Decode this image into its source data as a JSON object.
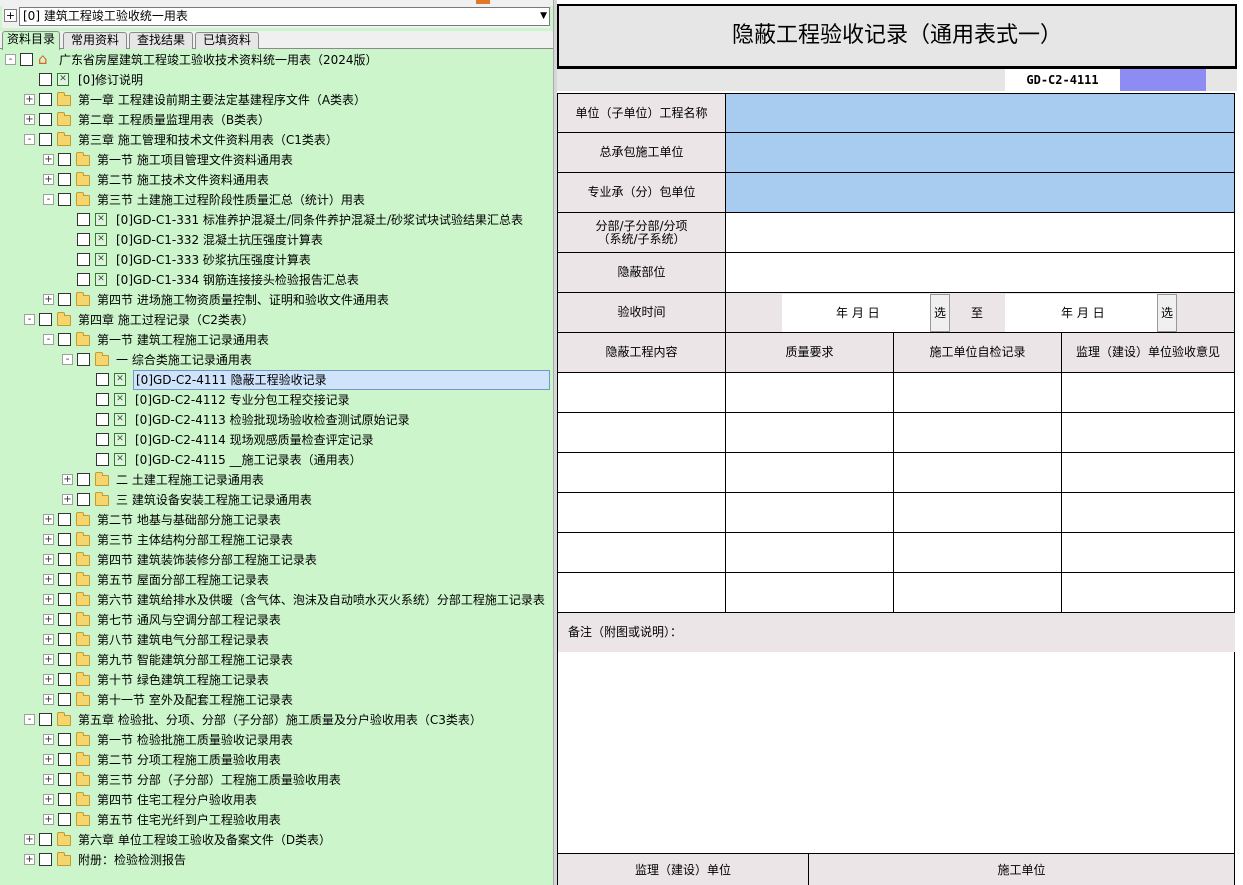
{
  "selector": {
    "expand_glyph": "+",
    "current": "[0] 建筑工程竣工验收统一用表",
    "arrow": "▼"
  },
  "tabs": [
    {
      "label": "资料目录",
      "active": true
    },
    {
      "label": "常用资料",
      "active": false
    },
    {
      "label": "查找结果",
      "active": false
    },
    {
      "label": "已填资料",
      "active": false
    }
  ],
  "tree": [
    {
      "depth": 0,
      "exp": "-",
      "icon": "home",
      "label": "广东省房屋建筑工程竣工验收技术资料统一用表（2024版）"
    },
    {
      "depth": 1,
      "exp": "",
      "icon": "file",
      "label": "[0]修订说明"
    },
    {
      "depth": 1,
      "exp": "+",
      "icon": "folder",
      "label": "第一章 工程建设前期主要法定基建程序文件（A类表）"
    },
    {
      "depth": 1,
      "exp": "+",
      "icon": "folder",
      "label": "第二章 工程质量监理用表（B类表）"
    },
    {
      "depth": 1,
      "exp": "-",
      "icon": "folder",
      "label": "第三章 施工管理和技术文件资料用表（C1类表）"
    },
    {
      "depth": 2,
      "exp": "+",
      "icon": "folder",
      "label": "第一节 施工项目管理文件资料通用表"
    },
    {
      "depth": 2,
      "exp": "+",
      "icon": "folder",
      "label": "第二节 施工技术文件资料通用表"
    },
    {
      "depth": 2,
      "exp": "-",
      "icon": "folder",
      "label": "第三节 土建施工过程阶段性质量汇总（统计）用表"
    },
    {
      "depth": 3,
      "exp": "",
      "icon": "file",
      "label": "[0]GD-C1-331 标准养护混凝土/同条件养护混凝土/砂浆试块试验结果汇总表"
    },
    {
      "depth": 3,
      "exp": "",
      "icon": "file",
      "label": "[0]GD-C1-332 混凝土抗压强度计算表"
    },
    {
      "depth": 3,
      "exp": "",
      "icon": "file",
      "label": "[0]GD-C1-333 砂浆抗压强度计算表"
    },
    {
      "depth": 3,
      "exp": "",
      "icon": "file",
      "label": "[0]GD-C1-334 钢筋连接接头检验报告汇总表"
    },
    {
      "depth": 2,
      "exp": "+",
      "icon": "folder",
      "label": "第四节 进场施工物资质量控制、证明和验收文件通用表"
    },
    {
      "depth": 1,
      "exp": "-",
      "icon": "folder",
      "label": "第四章 施工过程记录（C2类表）"
    },
    {
      "depth": 2,
      "exp": "-",
      "icon": "folder",
      "label": "第一节 建筑工程施工记录通用表"
    },
    {
      "depth": 3,
      "exp": "-",
      "icon": "folder",
      "label": "一 综合类施工记录通用表"
    },
    {
      "depth": 4,
      "exp": "",
      "icon": "file",
      "label": "[0]GD-C2-4111 隐蔽工程验收记录",
      "selected": true
    },
    {
      "depth": 4,
      "exp": "",
      "icon": "file",
      "label": "[0]GD-C2-4112 专业分包工程交接记录"
    },
    {
      "depth": 4,
      "exp": "",
      "icon": "file",
      "label": "[0]GD-C2-4113 检验批现场验收检查测试原始记录"
    },
    {
      "depth": 4,
      "exp": "",
      "icon": "file",
      "label": "[0]GD-C2-4114 现场观感质量检查评定记录"
    },
    {
      "depth": 4,
      "exp": "",
      "icon": "file",
      "label": "[0]GD-C2-4115 __施工记录表（通用表）"
    },
    {
      "depth": 3,
      "exp": "+",
      "icon": "folder",
      "label": "二 土建工程施工记录通用表"
    },
    {
      "depth": 3,
      "exp": "+",
      "icon": "folder",
      "label": "三 建筑设备安装工程施工记录通用表"
    },
    {
      "depth": 2,
      "exp": "+",
      "icon": "folder",
      "label": "第二节 地基与基础部分施工记录表"
    },
    {
      "depth": 2,
      "exp": "+",
      "icon": "folder",
      "label": "第三节 主体结构分部工程施工记录表"
    },
    {
      "depth": 2,
      "exp": "+",
      "icon": "folder",
      "label": "第四节 建筑装饰装修分部工程施工记录表"
    },
    {
      "depth": 2,
      "exp": "+",
      "icon": "folder",
      "label": "第五节 屋面分部工程施工记录表"
    },
    {
      "depth": 2,
      "exp": "+",
      "icon": "folder",
      "label": "第六节 建筑给排水及供暖（含气体、泡沫及自动喷水灭火系统）分部工程施工记录表"
    },
    {
      "depth": 2,
      "exp": "+",
      "icon": "folder",
      "label": "第七节 通风与空调分部工程记录表"
    },
    {
      "depth": 2,
      "exp": "+",
      "icon": "folder",
      "label": "第八节 建筑电气分部工程记录表"
    },
    {
      "depth": 2,
      "exp": "+",
      "icon": "folder",
      "label": "第九节 智能建筑分部工程施工记录表"
    },
    {
      "depth": 2,
      "exp": "+",
      "icon": "folder",
      "label": "第十节 绿色建筑工程施工记录表"
    },
    {
      "depth": 2,
      "exp": "+",
      "icon": "folder",
      "label": "第十一节 室外及配套工程施工记录表"
    },
    {
      "depth": 1,
      "exp": "-",
      "icon": "folder",
      "label": "第五章 检验批、分项、分部（子分部）施工质量及分户验收用表（C3类表）"
    },
    {
      "depth": 2,
      "exp": "+",
      "icon": "folder",
      "label": "第一节 检验批施工质量验收记录用表"
    },
    {
      "depth": 2,
      "exp": "+",
      "icon": "folder",
      "label": "第二节 分项工程施工质量验收用表"
    },
    {
      "depth": 2,
      "exp": "+",
      "icon": "folder",
      "label": "第三节 分部（子分部）工程施工质量验收用表"
    },
    {
      "depth": 2,
      "exp": "+",
      "icon": "folder",
      "label": "第四节 住宅工程分户验收用表"
    },
    {
      "depth": 2,
      "exp": "+",
      "icon": "folder",
      "label": "第五节 住宅光纤到户工程验收用表"
    },
    {
      "depth": 1,
      "exp": "+",
      "icon": "folder",
      "label": "第六章 单位工程竣工验收及备案文件（D类表）"
    },
    {
      "depth": 1,
      "exp": "+",
      "icon": "folder",
      "label": "附册：检验检测报告"
    }
  ],
  "form": {
    "title": "隐蔽工程验收记录（通用表式一）",
    "code": "GD-C2-4111",
    "fields": {
      "unit_project_name": "单位（子单位）工程名称",
      "general_contractor": "总承包施工单位",
      "subcontractor": "专业承（分）包单位",
      "division_line1": "分部/子分部/分项",
      "division_line2": "（系统/子系统）",
      "hidden_part": "隐蔽部位",
      "inspection_time": "验收时间"
    },
    "date_from": "年  月  日",
    "date_to": "年  月  日",
    "pick_label": "选",
    "to_label": "至",
    "columns": [
      "隐蔽工程内容",
      "质量要求",
      "施工单位自检记录",
      "监理（建设）单位验收意见"
    ],
    "remark_label": "备注（附图或说明）：",
    "footer": [
      "监理（建设）单位",
      "施工单位"
    ]
  }
}
